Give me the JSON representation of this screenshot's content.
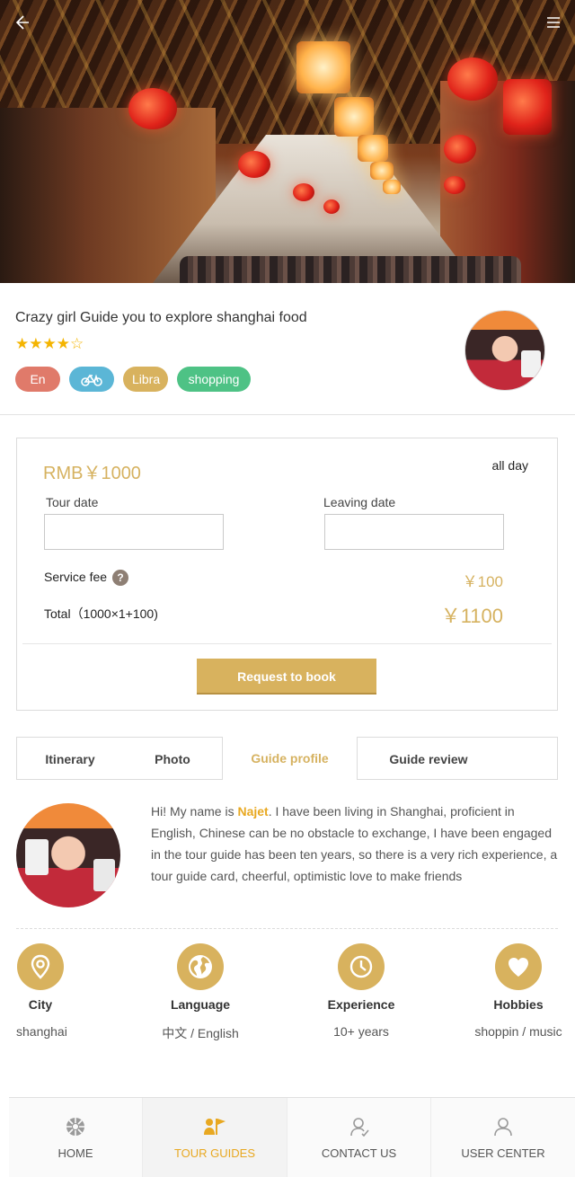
{
  "header": {
    "back_icon": "arrow-left-icon",
    "menu_icon": "hamburger-menu-icon"
  },
  "tour": {
    "title": "Crazy girl Guide you to explore  shanghai  food",
    "rating": 4,
    "rating_max": 5,
    "stars_text": "★★★★☆",
    "tags": [
      "En",
      "bike-icon",
      "Libra",
      "shopping"
    ]
  },
  "booking": {
    "price": "RMB￥1000",
    "duration": "all day",
    "tour_date_label": "Tour date",
    "tour_date_value": "",
    "leaving_date_label": "Leaving date",
    "leaving_date_value": "",
    "service_fee_label": "Service fee",
    "service_fee_help": "?",
    "service_fee_value": "￥100",
    "total_label": "Total（1000×1+100)",
    "total_value": "￥1100",
    "request_button": "Request to book"
  },
  "tabs": [
    "Itinerary",
    "Photo",
    "Guide profile",
    "Guide review"
  ],
  "active_tab": "Guide profile",
  "profile": {
    "bio_prefix": "Hi! My name is ",
    "name": "Najet",
    "bio_suffix": ". I have been living in Shanghai, proficient in English, Chinese can be no obstacle to exchange, I have been engaged in the tour guide has been ten years, so there is a very rich experience, a tour guide card, cheerful, optimistic love to make friends"
  },
  "stats": [
    {
      "icon": "location-pin-icon",
      "label": "City",
      "value": "shanghai"
    },
    {
      "icon": "globe-icon",
      "label": "Language",
      "value": "中文 / English"
    },
    {
      "icon": "clock-icon",
      "label": "Experience",
      "value": "10+ years"
    },
    {
      "icon": "heart-icon",
      "label": "Hobbies",
      "value": "shoppin / music"
    }
  ],
  "bottom_nav": [
    {
      "icon": "home-icon",
      "label": "HOME"
    },
    {
      "icon": "tour-guides-icon",
      "label": "TOUR GUIDES"
    },
    {
      "icon": "contact-icon",
      "label": "CONTACT US"
    },
    {
      "icon": "user-icon",
      "label": "USER CENTER"
    }
  ],
  "active_nav": "TOUR GUIDES",
  "colors": {
    "accent": "#d8b25e",
    "star": "#f4b400",
    "tag_en": "#e07a6a",
    "tag_bike": "#5bb6d6",
    "tag_libra": "#d8b25e",
    "tag_shopping": "#4ec285"
  }
}
